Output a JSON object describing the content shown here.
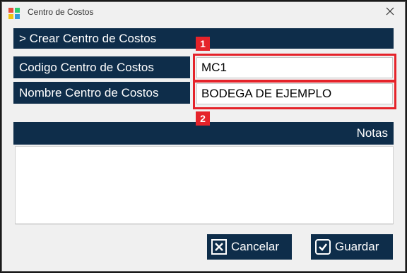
{
  "window": {
    "title": "Centro de Costos",
    "icon": "app-icon",
    "close_icon": "close-icon"
  },
  "form": {
    "header": "> Crear Centro de Costos",
    "code_label": "Codigo Centro de Costos",
    "code_value": "MC1",
    "name_label": "Nombre Centro de Costos",
    "name_value": "BODEGA DE EJEMPLO",
    "notes_label": "Notas",
    "notes_value": ""
  },
  "annotations": {
    "marker_1": "1",
    "marker_2": "2",
    "highlight_color": "#e5232a"
  },
  "buttons": {
    "cancel_label": "Cancelar",
    "cancel_icon": "x-box-icon",
    "save_label": "Guardar",
    "save_icon": "check-box-icon"
  },
  "colors": {
    "band": "#0e2d4a",
    "background": "#f0f0f0"
  }
}
